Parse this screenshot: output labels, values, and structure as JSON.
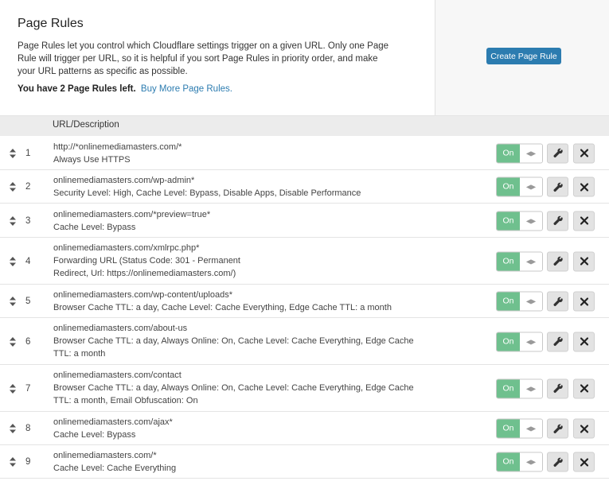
{
  "header": {
    "title": "Page Rules",
    "description": "Page Rules let you control which Cloudflare settings trigger on a given URL. Only one Page Rule will trigger per URL, so it is helpful if you sort Page Rules in priority order, and make your URL patterns as specific as possible.",
    "remaining_text": "You have 2 Page Rules left.",
    "buy_more_label": "Buy More Page Rules."
  },
  "actions": {
    "create_label": "Create Page Rule"
  },
  "table": {
    "header": "URL/Description",
    "rows": [
      {
        "num": "1",
        "url": "http://*onlinemediamasters.com/*",
        "desc": "Always Use HTTPS",
        "toggle": "On"
      },
      {
        "num": "2",
        "url": "onlinemediamasters.com/wp-admin*",
        "desc": "Security Level: High, Cache Level: Bypass, Disable Apps, Disable Performance",
        "toggle": "On"
      },
      {
        "num": "3",
        "url": "onlinemediamasters.com/*preview=true*",
        "desc": "Cache Level: Bypass",
        "toggle": "On"
      },
      {
        "num": "4",
        "url": "onlinemediamasters.com/xmlrpc.php*",
        "desc": "Forwarding URL (Status Code: 301 - Permanent Redirect, Url: https://onlinemediamasters.com/)",
        "toggle": "On"
      },
      {
        "num": "5",
        "url": "onlinemediamasters.com/wp-content/uploads*",
        "desc": "Browser Cache TTL: a day, Cache Level: Cache Everything, Edge Cache TTL: a month",
        "toggle": "On"
      },
      {
        "num": "6",
        "url": "onlinemediamasters.com/about-us",
        "desc": "Browser Cache TTL: a day, Always Online: On, Cache Level: Cache Everything, Edge Cache TTL: a month",
        "toggle": "On"
      },
      {
        "num": "7",
        "url": "onlinemediamasters.com/contact",
        "desc": "Browser Cache TTL: a day, Always Online: On, Cache Level: Cache Everything, Edge Cache TTL: a month, Email Obfuscation: On",
        "toggle": "On"
      },
      {
        "num": "8",
        "url": "onlinemediamasters.com/ajax*",
        "desc": "Cache Level: Bypass",
        "toggle": "On"
      },
      {
        "num": "9",
        "url": "onlinemediamasters.com/*",
        "desc": "Cache Level: Cache Everything",
        "toggle": "On"
      }
    ]
  },
  "colors": {
    "accent": "#2c7cb0",
    "toggle_on": "#6fc08e",
    "header_bg": "#ececec"
  },
  "icons": {
    "drag": "sort-arrows-icon",
    "toggle_knob": "left-right-arrows-icon",
    "edit": "wrench-icon",
    "delete": "close-icon"
  }
}
